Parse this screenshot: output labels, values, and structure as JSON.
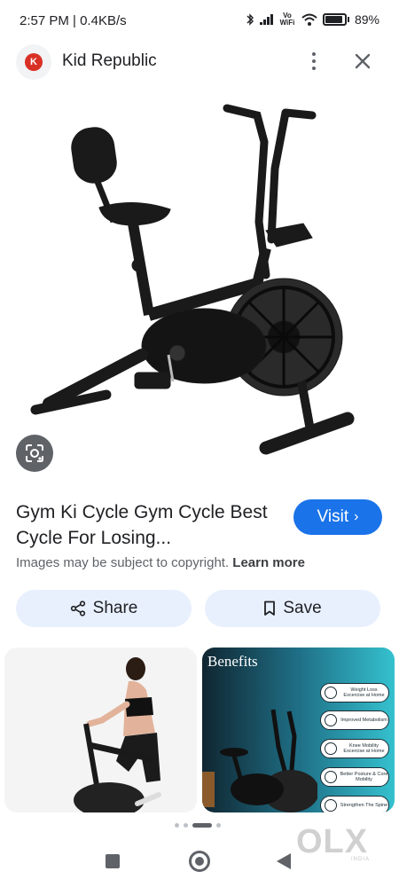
{
  "status_bar": {
    "time_speed": "2:57 PM | 0.4KB/s",
    "network_label": "Vo WiFi",
    "battery": "89%",
    "icons": [
      "mute-icon",
      "charge-icon",
      "bluetooth-icon",
      "signal-icon",
      "wifi-icon",
      "battery-icon"
    ]
  },
  "header": {
    "site_name": "Kid Republic",
    "icons": [
      "site-logo-icon",
      "more-vert-icon",
      "close-icon"
    ]
  },
  "result": {
    "title": "Gym Ki Cycle Gym Cycle Best Cycle For Losing...",
    "visit_label": "Visit",
    "visit_chevron": "›",
    "copyright_text": "Images may be subject to copyright.",
    "learn_more": "Learn more"
  },
  "actions": {
    "share_label": "Share",
    "save_label": "Save"
  },
  "related": {
    "item2_title": "Benefits",
    "badges": [
      "Weight Loss Excercise at Home",
      "Improved Metabolism",
      "Knee Mobility Excercise at Home",
      "Better Posture & Core Mobility",
      "Strengthen The Spine"
    ]
  },
  "watermark": {
    "logo": "OLX",
    "sub": "INDIA"
  },
  "colors": {
    "accent": "#1a73e8",
    "chip_bg": "#e8f0fe"
  }
}
